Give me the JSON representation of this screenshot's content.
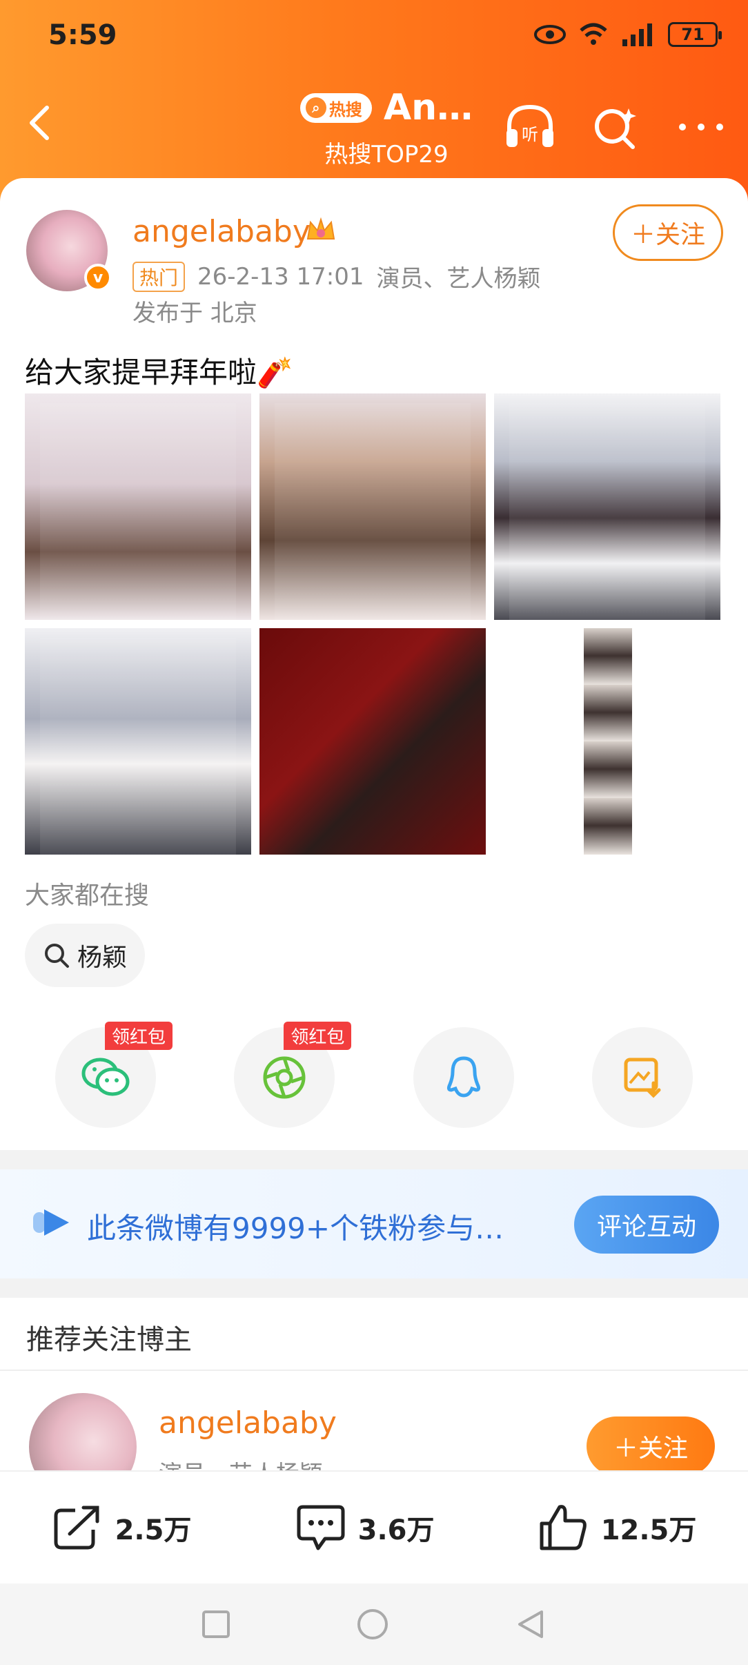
{
  "status_bar": {
    "time": "5:59",
    "battery": "71"
  },
  "nav": {
    "hot_label": "热搜",
    "title": "An…",
    "subtitle": "热搜TOP29"
  },
  "post": {
    "username": "angelababy",
    "hot_tag": "热门",
    "datetime": "26-2-13 17:01",
    "source": "演员、艺人杨颖",
    "location": "发布于 北京",
    "follow_label": "＋关注",
    "text": "给大家提早拜年啦🧨",
    "images_count": 6
  },
  "search": {
    "label": "大家都在搜",
    "chip": "杨颖"
  },
  "share": {
    "badge1": "领红包",
    "badge2": "领红包",
    "items": [
      "wechat-icon",
      "moments-icon",
      "qq-icon",
      "save-image-icon"
    ]
  },
  "fan_banner": {
    "text": "此条微博有9999+个铁粉参与…",
    "button": "评论互动"
  },
  "recommend": {
    "title": "推荐关注博主",
    "name": "angelababy",
    "desc": "演员、艺人杨颖",
    "follow_label": "＋关注"
  },
  "actions": {
    "repost": "2.5万",
    "comment": "3.6万",
    "like": "12.5万"
  },
  "colors": {
    "header_orange": "#ff7a1c",
    "username_orange": "#f07b1e",
    "link_blue": "#2f6fd6"
  }
}
